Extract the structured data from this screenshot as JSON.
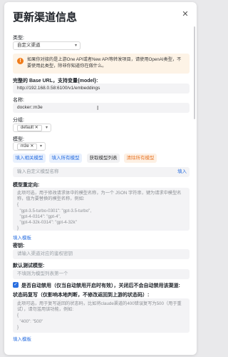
{
  "title": "更新渠道信息",
  "type": {
    "label": "类型:",
    "value": "自定义渠道"
  },
  "warning": "如果你对接的是上游One API或者New API等转发项目，请使用OpenAI类型，不要使用此类型，除非你知道你在做什么。",
  "base_url": {
    "label": "完整的 Base URL，支持变量{model}:",
    "value": "http://192.168.0.58:6100/v1/embeddings"
  },
  "name": {
    "label": "名称:",
    "value": "docker::m3e"
  },
  "group": {
    "label": "分组:",
    "tag": "default"
  },
  "model": {
    "label": "模型:",
    "tag": "m3e"
  },
  "buttons": {
    "fill_related": "填入相关模型",
    "fill_all": "填入所有模型",
    "fetch_list": "获取模型列表",
    "clear_all": "清除所有模型"
  },
  "custom_model": {
    "placeholder": "输入自定义模型名称",
    "fill": "填入"
  },
  "mapping": {
    "label": "模型重定向:",
    "text": "此项可选，用于修改请求体中的模型名称，为一个 JSON 字符串，键为请求中模型名称，值为要替换的模型名称，例如:\n{\n  \"gpt-3.5-turbo-0301\": \"gpt-3.5-turbo\",\n  \"gpt-4-0314\": \"gpt-4\",\n  \"gpt-4-32k-0314\": \"gpt-4-32k\"\n}",
    "template": "填入模板"
  },
  "key": {
    "label": "密钥:",
    "placeholder": "请输入渠道对应的鉴权密钥"
  },
  "test_model": {
    "label": "默认测试模型:",
    "placeholder": "不填则为模型列表第一个"
  },
  "auto_disable": {
    "checked": true,
    "text": "是否自动禁用（仅当自动禁用开启时有效），关闭后不会自动禁用该渠道:"
  },
  "status_override": {
    "label": "状态码复写（仅影响本地判断，不修改返回到上游的状态码）:",
    "text": "此项可选，用于复写返回的状态码，比如将claude渠道的400错误复写为500（用于重试），请勿滥用该功能，例如:\n{\n  \"400\": \"500\"\n}",
    "template": "填入模板"
  }
}
